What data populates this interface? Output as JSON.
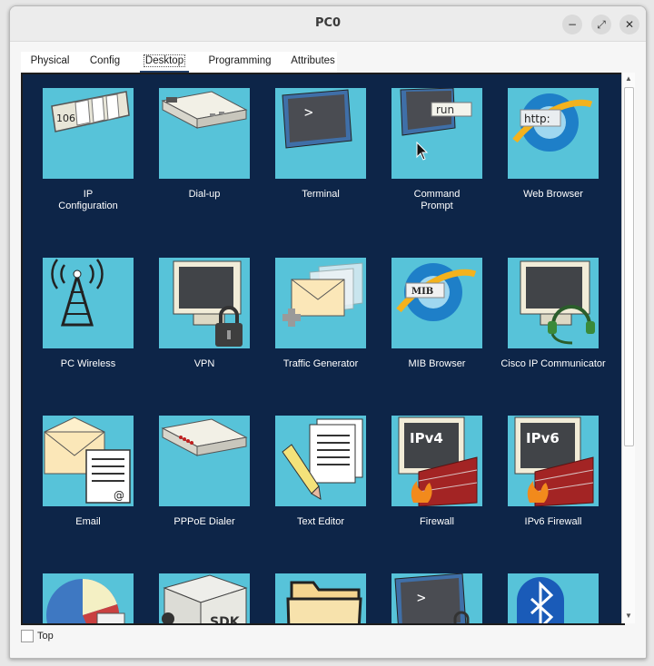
{
  "window": {
    "title": "PC0",
    "buttons": {
      "minimize": "−",
      "maximize": "⤢",
      "close": "✕"
    }
  },
  "tabs": [
    {
      "label": "Physical",
      "active": false
    },
    {
      "label": "Config",
      "active": false
    },
    {
      "label": "Desktop",
      "active": true
    },
    {
      "label": "Programming",
      "active": false
    },
    {
      "label": "Attributes",
      "active": false
    }
  ],
  "apps": [
    {
      "label": "IP",
      "label2": "Configuration",
      "icon": "ip-config-icon"
    },
    {
      "label": "Dial-up",
      "label2": "",
      "icon": "dialup-modem-icon"
    },
    {
      "label": "Terminal",
      "label2": "",
      "icon": "terminal-icon"
    },
    {
      "label": "Command",
      "label2": "Prompt",
      "icon": "command-prompt-icon"
    },
    {
      "label": "Web Browser",
      "label2": "",
      "icon": "web-browser-icon"
    },
    {
      "label": "PC Wireless",
      "label2": "",
      "icon": "wireless-tower-icon"
    },
    {
      "label": "VPN",
      "label2": "",
      "icon": "vpn-lock-icon"
    },
    {
      "label": "Traffic Generator",
      "label2": "",
      "icon": "traffic-generator-icon"
    },
    {
      "label": "MIB Browser",
      "label2": "",
      "icon": "mib-browser-icon"
    },
    {
      "label": "Cisco IP Communicator",
      "label2": "",
      "icon": "ip-communicator-headset-icon"
    },
    {
      "label": "Email",
      "label2": "",
      "icon": "email-icon"
    },
    {
      "label": "PPPoE Dialer",
      "label2": "",
      "icon": "pppoe-dialer-icon"
    },
    {
      "label": "Text Editor",
      "label2": "",
      "icon": "text-editor-icon"
    },
    {
      "label": "Firewall",
      "label2": "",
      "icon": "firewall-icon"
    },
    {
      "label": "IPv6 Firewall",
      "label2": "",
      "icon": "ipv6-firewall-icon"
    },
    {
      "label": "",
      "label2": "",
      "icon": "pie-chart-icon"
    },
    {
      "label": "",
      "label2": "",
      "icon": "sdk-box-icon"
    },
    {
      "label": "",
      "label2": "",
      "icon": "folder-icon"
    },
    {
      "label": "",
      "label2": "",
      "icon": "secure-terminal-icon"
    },
    {
      "label": "",
      "label2": "",
      "icon": "bluetooth-icon"
    }
  ],
  "icon_text": {
    "ip": "106",
    "run": "run",
    "http": "http:",
    "mib": "MIB",
    "ipv4": "IPv4",
    "ipv6": "IPv6",
    "sdk": "SDK",
    "prompt": ">"
  },
  "footer": {
    "top_label": "Top",
    "top_checked": false
  },
  "colors": {
    "panel": "#0d2548",
    "tile": "#57c3d9",
    "active_tab_underline": "#1e3c66"
  }
}
